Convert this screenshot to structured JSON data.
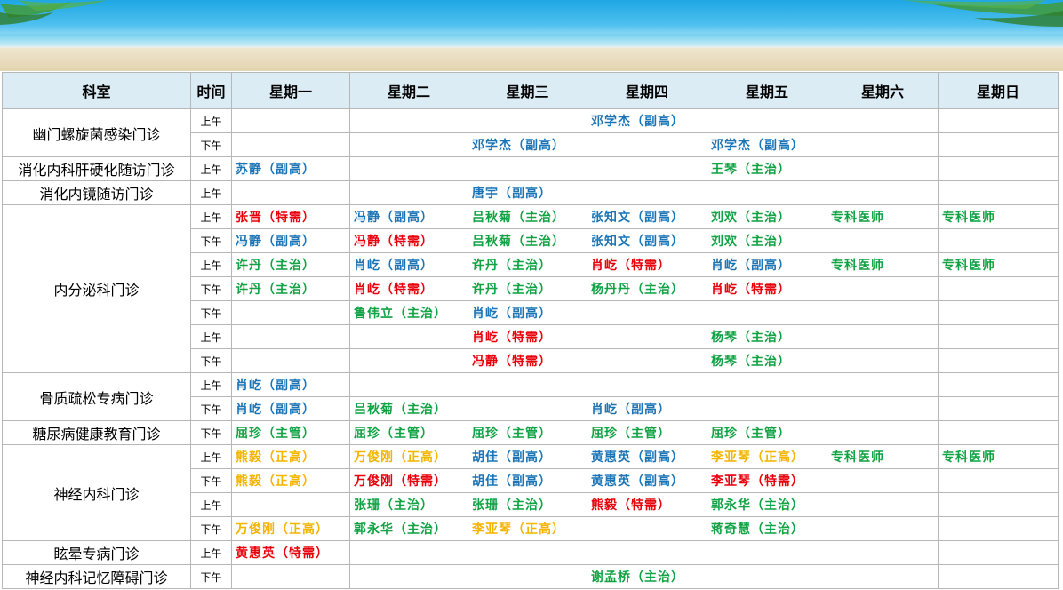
{
  "colors": {
    "特需": "#e8000b",
    "副高": "#1a74b6",
    "主治": "#10a243",
    "主管": "#10a243",
    "正高": "#f4b400",
    "专科医师": "#10a243"
  },
  "header": [
    "科室",
    "时间",
    "星期一",
    "星期二",
    "星期三",
    "星期四",
    "星期五",
    "星期六",
    "星期日"
  ],
  "rows": [
    {
      "dept": "幽门螺旋菌感染门诊",
      "span": 2,
      "time": "上午",
      "cells": [
        "",
        "",
        "",
        "邓学杰（副高）",
        "",
        "",
        ""
      ]
    },
    {
      "time": "下午",
      "cells": [
        "",
        "",
        "邓学杰（副高）",
        "",
        "邓学杰（副高）",
        "",
        ""
      ]
    },
    {
      "dept": "消化内科肝硬化随访门诊",
      "span": 1,
      "time": "上午",
      "cells": [
        "苏静（副高）",
        "",
        "",
        "",
        "王琴（主治）",
        "",
        ""
      ]
    },
    {
      "dept": "消化内镜随访门诊",
      "span": 1,
      "time": "上午",
      "cells": [
        "",
        "",
        "唐宇（副高）",
        "",
        "",
        "",
        ""
      ]
    },
    {
      "dept": "内分泌科门诊",
      "span": 7,
      "time": "上午",
      "cells": [
        "张晋（特需）",
        "冯静（副高）",
        "吕秋菊（主治）",
        "张知文（副高）",
        "刘欢（主治）",
        "专科医师",
        "专科医师"
      ]
    },
    {
      "time": "下午",
      "cells": [
        "冯静（副高）",
        "冯静（特需）",
        "吕秋菊（主治）",
        "张知文（副高）",
        "刘欢（主治）",
        "",
        ""
      ]
    },
    {
      "time": "上午",
      "cells": [
        "许丹（主治）",
        "肖屹（副高）",
        "许丹（主治）",
        "肖屹（特需）",
        "肖屹（副高）",
        "专科医师",
        "专科医师"
      ]
    },
    {
      "time": "下午",
      "cells": [
        "许丹（主治）",
        "肖屹（特需）",
        "许丹（主治）",
        "杨丹丹（主治）",
        "肖屹（特需）",
        "",
        ""
      ]
    },
    {
      "time": "下午",
      "cells": [
        "",
        "鲁伟立（主治）",
        "肖屹（副高）",
        "",
        "",
        "",
        ""
      ]
    },
    {
      "time": "上午",
      "cells": [
        "",
        "",
        "肖屹（特需）",
        "",
        "杨琴（主治）",
        "",
        ""
      ]
    },
    {
      "time": "下午",
      "cells": [
        "",
        "",
        "冯静（特需）",
        "",
        "杨琴（主治）",
        "",
        ""
      ]
    },
    {
      "dept": "骨质疏松专病门诊",
      "span": 2,
      "time": "上午",
      "cells": [
        "肖屹（副高）",
        "",
        "",
        "",
        "",
        "",
        ""
      ]
    },
    {
      "time": "下午",
      "cells": [
        "肖屹（副高）",
        "吕秋菊（主治）",
        "",
        "肖屹（副高）",
        "",
        "",
        ""
      ]
    },
    {
      "dept": "糖尿病健康教育门诊",
      "span": 1,
      "time": "下午",
      "cells": [
        "屈珍（主管）",
        "屈珍（主管）",
        "屈珍（主管）",
        "屈珍（主管）",
        "屈珍（主管）",
        "",
        ""
      ]
    },
    {
      "dept": "神经内科门诊",
      "span": 4,
      "time": "上午",
      "cells": [
        "熊毅（正高）",
        "万俊刚（正高）",
        "胡佳（副高）",
        "黄惠英（副高）",
        "李亚琴（正高）",
        "专科医师",
        "专科医师"
      ]
    },
    {
      "time": "下午",
      "cells": [
        "熊毅（正高）",
        "万俊刚（特需）",
        "胡佳（副高）",
        "黄惠英（副高）",
        "李亚琴（特需）",
        "",
        ""
      ]
    },
    {
      "time": "上午",
      "cells": [
        "",
        "张珊（主治）",
        "张珊（主治）",
        "熊毅（特需）",
        "郭永华（主治）",
        "",
        ""
      ]
    },
    {
      "time": "下午",
      "cells": [
        "万俊刚（正高）",
        "郭永华（主治）",
        "李亚琴（正高）",
        "",
        "蒋奇慧（主治）",
        "",
        ""
      ]
    },
    {
      "dept": "眩晕专病门诊",
      "span": 1,
      "time": "上午",
      "cells": [
        "黄惠英（特需）",
        "",
        "",
        "",
        "",
        "",
        ""
      ]
    },
    {
      "dept": "神经内科记忆障碍门诊",
      "span": 1,
      "time": "下午",
      "cells": [
        "",
        "",
        "",
        "谢孟桥（主治）",
        "",
        "",
        ""
      ]
    }
  ]
}
